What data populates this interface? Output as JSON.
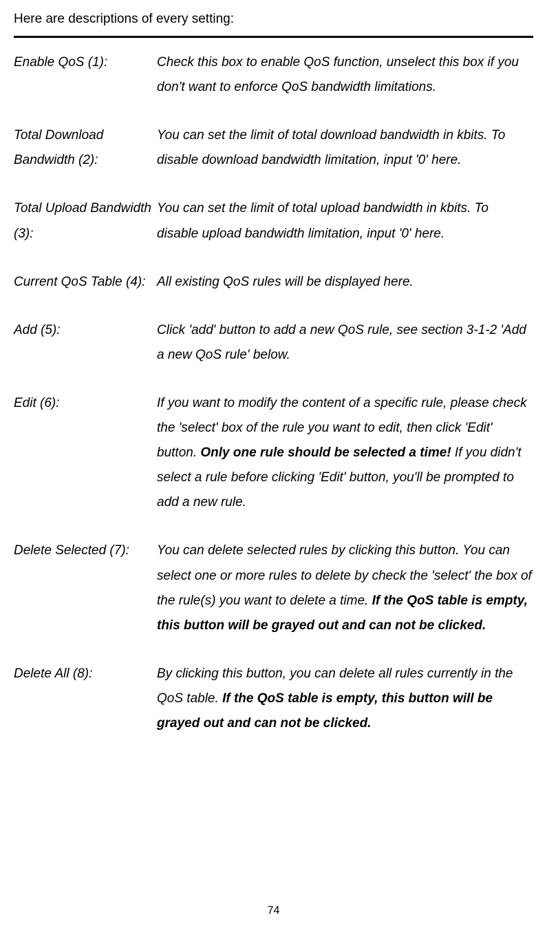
{
  "intro": "Here are descriptions of every setting:",
  "settings": [
    {
      "label": "Enable QoS (1):",
      "desc_parts": [
        {
          "text": "Check this box to enable QoS function, unselect this box if you don't want to enforce QoS bandwidth limitations.",
          "bold": false
        }
      ]
    },
    {
      "label": "Total Download Bandwidth (2):",
      "desc_parts": [
        {
          "text": "You can set the limit of total download bandwidth in kbits. To disable download bandwidth limitation, input '0' here.",
          "bold": false
        }
      ]
    },
    {
      "label": "Total Upload Bandwidth (3):",
      "desc_parts": [
        {
          "text": "You can set the limit of total upload bandwidth in kbits. To disable upload bandwidth limitation, input '0' here.",
          "bold": false
        }
      ]
    },
    {
      "label": "Current QoS Table (4):",
      "desc_parts": [
        {
          "text": "All existing QoS rules will be displayed here.",
          "bold": false
        }
      ]
    },
    {
      "label": "Add (5):",
      "desc_parts": [
        {
          "text": "Click 'add' button to add a new QoS rule, see section 3-1-2 'Add a new QoS rule' below.",
          "bold": false
        }
      ]
    },
    {
      "label": "Edit (6):",
      "desc_parts": [
        {
          "text": "If you want to modify the content of a specific rule, please check the 'select' box of the rule you want to edit, then click 'Edit' button. ",
          "bold": false
        },
        {
          "text": "Only one rule should be selected a time!",
          "bold": true
        },
        {
          "text": " If you didn't select a rule before clicking 'Edit' button, you'll be prompted to add a new rule.",
          "bold": false
        }
      ]
    },
    {
      "label": "Delete Selected (7):",
      "desc_parts": [
        {
          "text": "You can delete selected rules by clicking this button. You can select one or more rules to delete by check the 'select' the box of the rule(s) you want to delete a time. ",
          "bold": false
        },
        {
          "text": "If the QoS table is empty, this button will be grayed out and can not be clicked.",
          "bold": true
        }
      ]
    },
    {
      "label": "Delete All (8):",
      "desc_parts": [
        {
          "text": "By clicking this button, you can delete all rules currently in the QoS table. ",
          "bold": false
        },
        {
          "text": "If the QoS table is empty, this button will be grayed out and can not be clicked.",
          "bold": true
        }
      ]
    }
  ],
  "page_number": "74"
}
